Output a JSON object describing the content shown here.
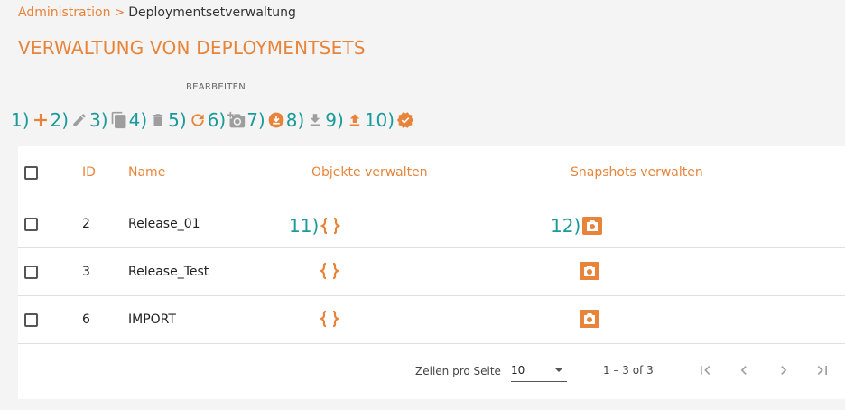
{
  "breadcrumb": {
    "parent": "Administration",
    "separator": ">",
    "current": "Deploymentsetverwaltung"
  },
  "page_title": "VERWALTUNG VON DEPLOYMENTSETS",
  "toolbar": {
    "group_label": "BEARBEITEN",
    "buttons": [
      {
        "num": "1)",
        "icon": "plus-icon"
      },
      {
        "num": "2)",
        "icon": "edit-icon"
      },
      {
        "num": "3)",
        "icon": "copy-icon"
      },
      {
        "num": "4)",
        "icon": "delete-icon"
      },
      {
        "num": "5)",
        "icon": "refresh-icon"
      },
      {
        "num": "6)",
        "icon": "add-snapshot-icon"
      },
      {
        "num": "7)",
        "icon": "download-circle-icon"
      },
      {
        "num": "8)",
        "icon": "download-icon"
      },
      {
        "num": "9)",
        "icon": "upload-icon"
      },
      {
        "num": "10)",
        "icon": "verified-badge-icon"
      }
    ]
  },
  "table": {
    "headers": {
      "id": "ID",
      "name": "Name",
      "objects": "Objekte verwalten",
      "snapshots": "Snapshots verwalten"
    },
    "rows": [
      {
        "id": "2",
        "name": "Release_01",
        "obj_num": "11)",
        "snap_num": "12)"
      },
      {
        "id": "3",
        "name": "Release_Test",
        "obj_num": "",
        "snap_num": ""
      },
      {
        "id": "6",
        "name": "IMPORT",
        "obj_num": "",
        "snap_num": ""
      }
    ]
  },
  "pagination": {
    "rows_per_page_label": "Zeilen pro Seite",
    "rows_per_page": "10",
    "range": "1 – 3 of 3"
  },
  "colors": {
    "accent": "#e8843a",
    "annotation": "#1a9a9a",
    "icon_gray": "#9e9e9e"
  }
}
